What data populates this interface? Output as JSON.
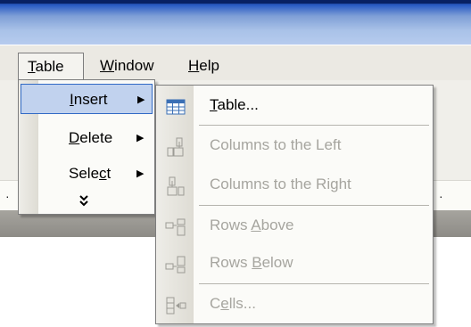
{
  "menubar": {
    "table": "Table",
    "window": "Window",
    "help": "Help"
  },
  "table_menu": {
    "insert": "Insert",
    "delete": "Delete",
    "select": "Select",
    "expand": "»"
  },
  "insert_submenu": {
    "items": [
      {
        "label": "Table...",
        "enabled": true
      },
      {
        "label": "Columns to the Left",
        "enabled": false
      },
      {
        "label": "Columns to the Right",
        "enabled": false
      },
      {
        "label": "Rows Above",
        "enabled": false
      },
      {
        "label": "Rows Below",
        "enabled": false
      },
      {
        "label": "Cells...",
        "enabled": false
      }
    ]
  },
  "colors": {
    "highlight_bg": "#c1d2ee",
    "highlight_border": "#316ac5",
    "disabled_text": "#a6a59f"
  },
  "icons": [
    "insert-table-icon",
    "insert-columns-left-icon",
    "insert-columns-right-icon",
    "insert-rows-above-icon",
    "insert-rows-below-icon",
    "insert-cells-icon",
    "submenu-arrow-icon",
    "expand-chevrons-icon"
  ]
}
